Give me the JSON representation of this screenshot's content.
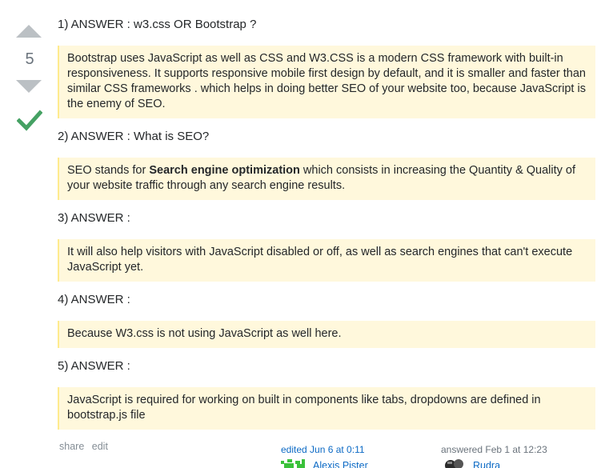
{
  "vote": {
    "count": "5"
  },
  "sections": [
    {
      "heading": "1) ANSWER : w3.css OR Bootstrap ?",
      "text": "Bootstrap uses JavaScript as well as CSS and W3.CSS is a modern CSS framework with built-in responsiveness. It supports responsive mobile first design by default, and it is smaller and faster than similar CSS frameworks . which helps in doing better SEO of your website too, because JavaScript is the enemy of SEO."
    },
    {
      "heading": "2) ANSWER : What is SEO?",
      "text_before": "SEO stands for ",
      "bold": "Search engine optimization",
      "text_after": " which consists in increasing the Quantity & Quality of your website traffic through any search engine results."
    },
    {
      "heading": "3) ANSWER :",
      "text": "It will also help visitors with JavaScript disabled or off, as well as search engines that can't execute JavaScript yet."
    },
    {
      "heading": "4) ANSWER :",
      "text": "Because W3.css is not using JavaScript as well here."
    },
    {
      "heading": "5) ANSWER :",
      "text": "JavaScript is required for working on built in components like tabs, dropdowns are defined in bootstrap.js file"
    }
  ],
  "menu": {
    "share": "share",
    "edit": "edit"
  },
  "edited": {
    "label": "edited Jun 6 at 0:11",
    "user": "Alexis Pister"
  },
  "answered": {
    "label": "answered Feb 1 at 12:23",
    "user": "Rudra"
  }
}
